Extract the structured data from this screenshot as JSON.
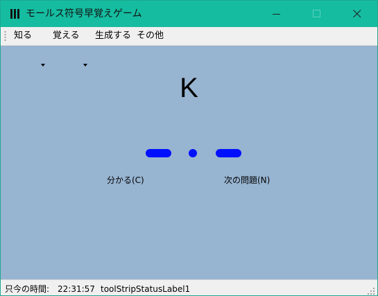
{
  "window": {
    "title": "モールス符号早覚えゲーム",
    "icon": "app-icon",
    "controls": [
      "minimize-icon",
      "maximize-icon",
      "close-icon"
    ]
  },
  "menu": {
    "items": [
      {
        "label": "知る",
        "has_dropdown": true
      },
      {
        "label": "覚える",
        "has_dropdown": true
      },
      {
        "label": "生成する",
        "has_dropdown": false
      },
      {
        "label": "その他",
        "has_dropdown": false
      }
    ]
  },
  "main": {
    "letter": "K",
    "morse": [
      "dash",
      "dot",
      "dash"
    ],
    "morse_color": "#0010ff",
    "background_color": "#97b4d1",
    "buttons": {
      "understood": "分かる(C)",
      "next_question": "次の問題(N)"
    }
  },
  "status": {
    "time_label": "只今の時間:",
    "time_value": "22:31:57",
    "label1": "toolStripStatusLabel1"
  },
  "colors": {
    "titlebar": "#15bca0",
    "menubar": "#f0f0f0",
    "statusbar": "#f0f0f0"
  }
}
